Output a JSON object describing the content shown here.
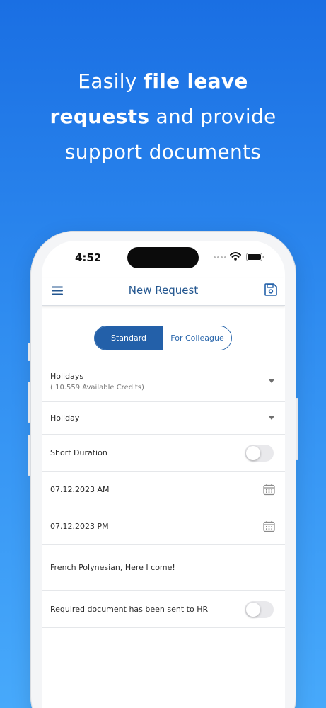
{
  "hero": {
    "line1_light": "Easily ",
    "line1_bold": "file leave",
    "line2_bold": "requests",
    "line2_light": " and provide",
    "line3": "support documents"
  },
  "status": {
    "time": "4:52"
  },
  "app_bar": {
    "title": "New Request"
  },
  "segment": {
    "standard": "Standard",
    "colleague": "For Colleague"
  },
  "form": {
    "leave_type": {
      "label": "Holidays",
      "credits": "( 10.559 Available Credits)"
    },
    "sub_type": {
      "label": "Holiday"
    },
    "short_duration": {
      "label": "Short Duration",
      "enabled": false
    },
    "start_date": {
      "value": "07.12.2023 AM"
    },
    "end_date": {
      "value": "07.12.2023 PM"
    },
    "note": {
      "value": "French Polynesian,  Here I come!"
    },
    "document_sent": {
      "label": "Required document has been sent to HR",
      "enabled": false
    }
  },
  "colors": {
    "primary": "#2360a9",
    "title": "#23568f",
    "gradient_top": "#1a6fe3",
    "gradient_bottom": "#47a9fb"
  }
}
